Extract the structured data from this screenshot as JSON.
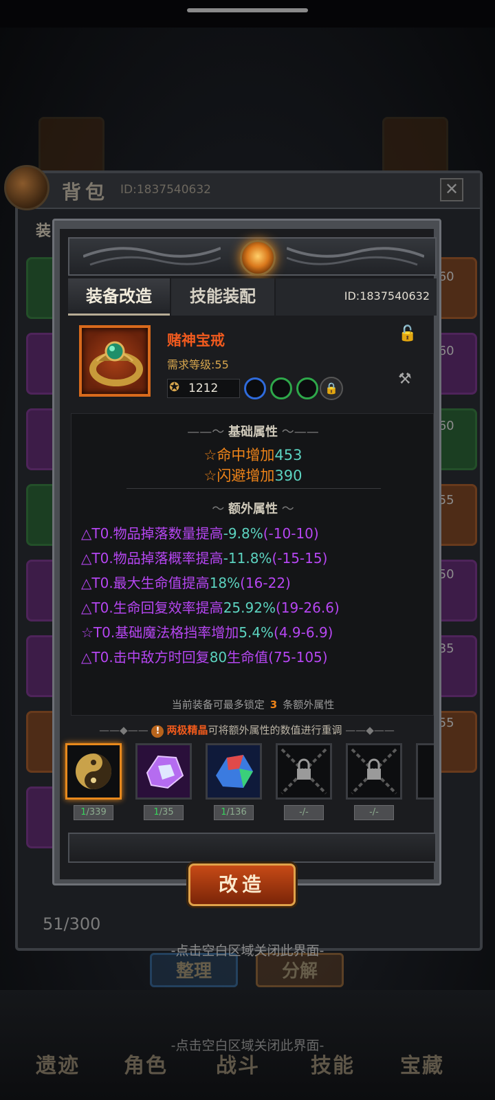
{
  "background": {
    "bag_title": "背包",
    "bag_id": "ID:1837540632",
    "close_symbol": "✕",
    "bag_tab_partial": "装",
    "count": "51/300",
    "sort_button": "整理",
    "split_button": "分解",
    "slot_levels": [
      ".60",
      ".60",
      ".60",
      ".55",
      ".50",
      ".35",
      ".55"
    ],
    "nav": [
      "遗迹",
      "角色",
      "战斗",
      "技能",
      "宝藏"
    ],
    "close_hint": "-点击空白区域关闭此界面-"
  },
  "dialog": {
    "tabs": {
      "active": "装备改造",
      "inactive": "技能装配"
    },
    "id_text": "ID:1837540632",
    "item": {
      "name": "赌神宝戒",
      "requirement": "需求等级:55",
      "power": "1212",
      "sockets": [
        "blue",
        "green",
        "green",
        "locked"
      ]
    },
    "base_section": {
      "title": "基础属性",
      "lines": [
        {
          "label": "☆命中增加",
          "value": "453"
        },
        {
          "label": "☆闪避增加",
          "value": "390"
        }
      ]
    },
    "extra_section": {
      "title": "额外属性",
      "lines": [
        {
          "prefix": "△T0.物品掉落数量提高",
          "value": "-9.8%",
          "range": "(-10-10)"
        },
        {
          "prefix": "△T0.物品掉落概率提高",
          "value": "-11.8%",
          "range": "(-15-15)"
        },
        {
          "prefix": "△T0.最大生命值提高",
          "value": "18%",
          "range": "(16-22)"
        },
        {
          "prefix": "△T0.生命回复效率提高",
          "value": "25.92%",
          "range": "(19-26.6)"
        },
        {
          "prefix": "☆T0.基础魔法格挡率增加",
          "value": "5.4%",
          "range": "(4.9-6.9)"
        },
        {
          "prefix": "△T0.击中敌方时回复",
          "value": "80",
          "range": "生命值(75-105)"
        }
      ]
    },
    "lock_note": {
      "before": "当前装备可最多锁定",
      "num": "3",
      "after": "条额外属性"
    },
    "hint": {
      "icon": "!",
      "highlight": "两极精晶",
      "rest": "可将额外属性的数值进行重调"
    },
    "materials": [
      {
        "name": "yin-yang-crystal",
        "have": "1",
        "need": "/339",
        "selected": true
      },
      {
        "name": "purple-crystal",
        "have": "1",
        "need": "/35",
        "selected": false
      },
      {
        "name": "rainbow-crystal",
        "have": "1",
        "need": "/136",
        "selected": false
      },
      {
        "name": "locked-slot",
        "have": "",
        "need": "-/-",
        "selected": false
      },
      {
        "name": "locked-slot",
        "have": "",
        "need": "-/-",
        "selected": false
      }
    ],
    "reforge_button": "改造",
    "close_hint": "-点击空白区域关闭此界面-"
  },
  "colors": {
    "accent_orange": "#ef8419",
    "cyan": "#5cd3c0",
    "purple": "#b646f2",
    "rarity_orange": "#d86a1c"
  }
}
